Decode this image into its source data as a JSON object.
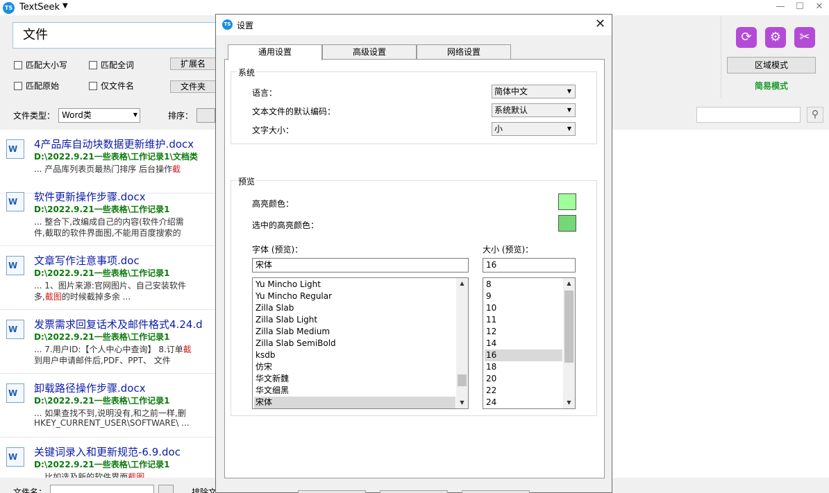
{
  "app": {
    "title": "TextSeek",
    "logo": "TS",
    "dropdown_icon": "▼",
    "minimize": "—",
    "maximize": "☐",
    "close": "✕"
  },
  "search": {
    "query": "文件"
  },
  "options": {
    "match_case": "匹配大小写",
    "match_whole": "匹配全词",
    "match_raw": "匹配原始",
    "filename_only": "仅文件名",
    "ext_button": "扩展名",
    "folder_button": "文件夹"
  },
  "filter": {
    "file_type_label": "文件类型：",
    "file_type_value": "Word类",
    "sort_label": "排序："
  },
  "right_panel": {
    "icons": [
      "refresh-icon",
      "gear-icon",
      "tools-icon"
    ],
    "region_mode": "区域模式",
    "simple_mode": "简易模式",
    "accent_purple": "#b44bd6",
    "simple_mode_color": "#1a9b2a"
  },
  "results": [
    {
      "title": "4产品库自动块数据更新维护.docx",
      "path": "D:\\2022.9.21一些表格\\工作记录1\\文档类",
      "snippet": "... 产品库列表页最热门排序 后台操作",
      "hl": "截",
      "snippet2": ""
    },
    {
      "title": "软件更新操作步骤.docx",
      "path": "D:\\2022.9.21一些表格\\工作记录1",
      "snippet": "... 整合下,改编成自己的内容(软件介绍需",
      "hl": "",
      "snippet2": "件,截取的软件界面图,不能用百度搜索的"
    },
    {
      "title": "文章写作注意事项.doc",
      "path": "D:\\2022.9.21一些表格\\工作记录1",
      "snippet": "... 1、图片来源:官网图片、自己安装软件",
      "hl": "",
      "snippet2": "多,",
      "hl2": "截图",
      "snippet2b": "的时候截掉多余 ..."
    },
    {
      "title": "发票需求回复话术及邮件格式4.24.d",
      "path": "D:\\2022.9.21一些表格\\工作记录1",
      "snippet": "... 7.用户ID:【个人中心中查询】 8.订单",
      "hl": "截",
      "snippet2": "到用户申请邮件后,PDF、PPT、 文件"
    },
    {
      "title": "卸载路径操作步骤.docx",
      "path": "D:\\2022.9.21一些表格\\工作记录1",
      "snippet": "... 如果查找不到,说明没有,和之前一样,删",
      "hl": "",
      "snippet2": "HKEY_CURRENT_USER\\SOFTWARE\\ ..."
    },
    {
      "title": "关键词录入和更新规范-6.9.doc",
      "path": "D:\\2022.9.21一些表格\\工作记录1",
      "snippet": "... 比如选及新的软件界面",
      "hl": "截图",
      "snippet2": ""
    }
  ],
  "bottom": {
    "filename_label": "文件名：",
    "exclude_label": "排除文"
  },
  "dialog": {
    "title": "设置",
    "close": "✕",
    "tabs": [
      "通用设置",
      "高级设置",
      "网络设置"
    ],
    "system": {
      "group_title": "系统",
      "language_label": "语言：",
      "language_value": "简体中文",
      "encoding_label": "文本文件的默认编码：",
      "encoding_value": "系统默认",
      "textsize_label": "文字大小：",
      "textsize_value": "小"
    },
    "preview": {
      "group_title": "预览",
      "highlight_label": "高亮颜色：",
      "highlight_color": "#a0ff98",
      "selected_highlight_label": "选中的高亮颜色：",
      "selected_highlight_color": "#74d874",
      "font_label": "字体 (预览)：",
      "font_value": "宋体",
      "size_label": "大小 (预览)：",
      "size_value": "16",
      "fonts": [
        "Yu Mincho Light",
        "Yu Mincho Regular",
        "Zilla Slab",
        "Zilla Slab Light",
        "Zilla Slab Medium",
        "Zilla Slab SemiBold",
        "ksdb",
        "仿宋",
        "华文新魏",
        "华文细黑",
        "宋体"
      ],
      "sizes": [
        "8",
        "9",
        "10",
        "11",
        "12",
        "14",
        "16",
        "18",
        "20",
        "22",
        "24"
      ],
      "selected_font": "宋体",
      "selected_size": "16"
    }
  }
}
